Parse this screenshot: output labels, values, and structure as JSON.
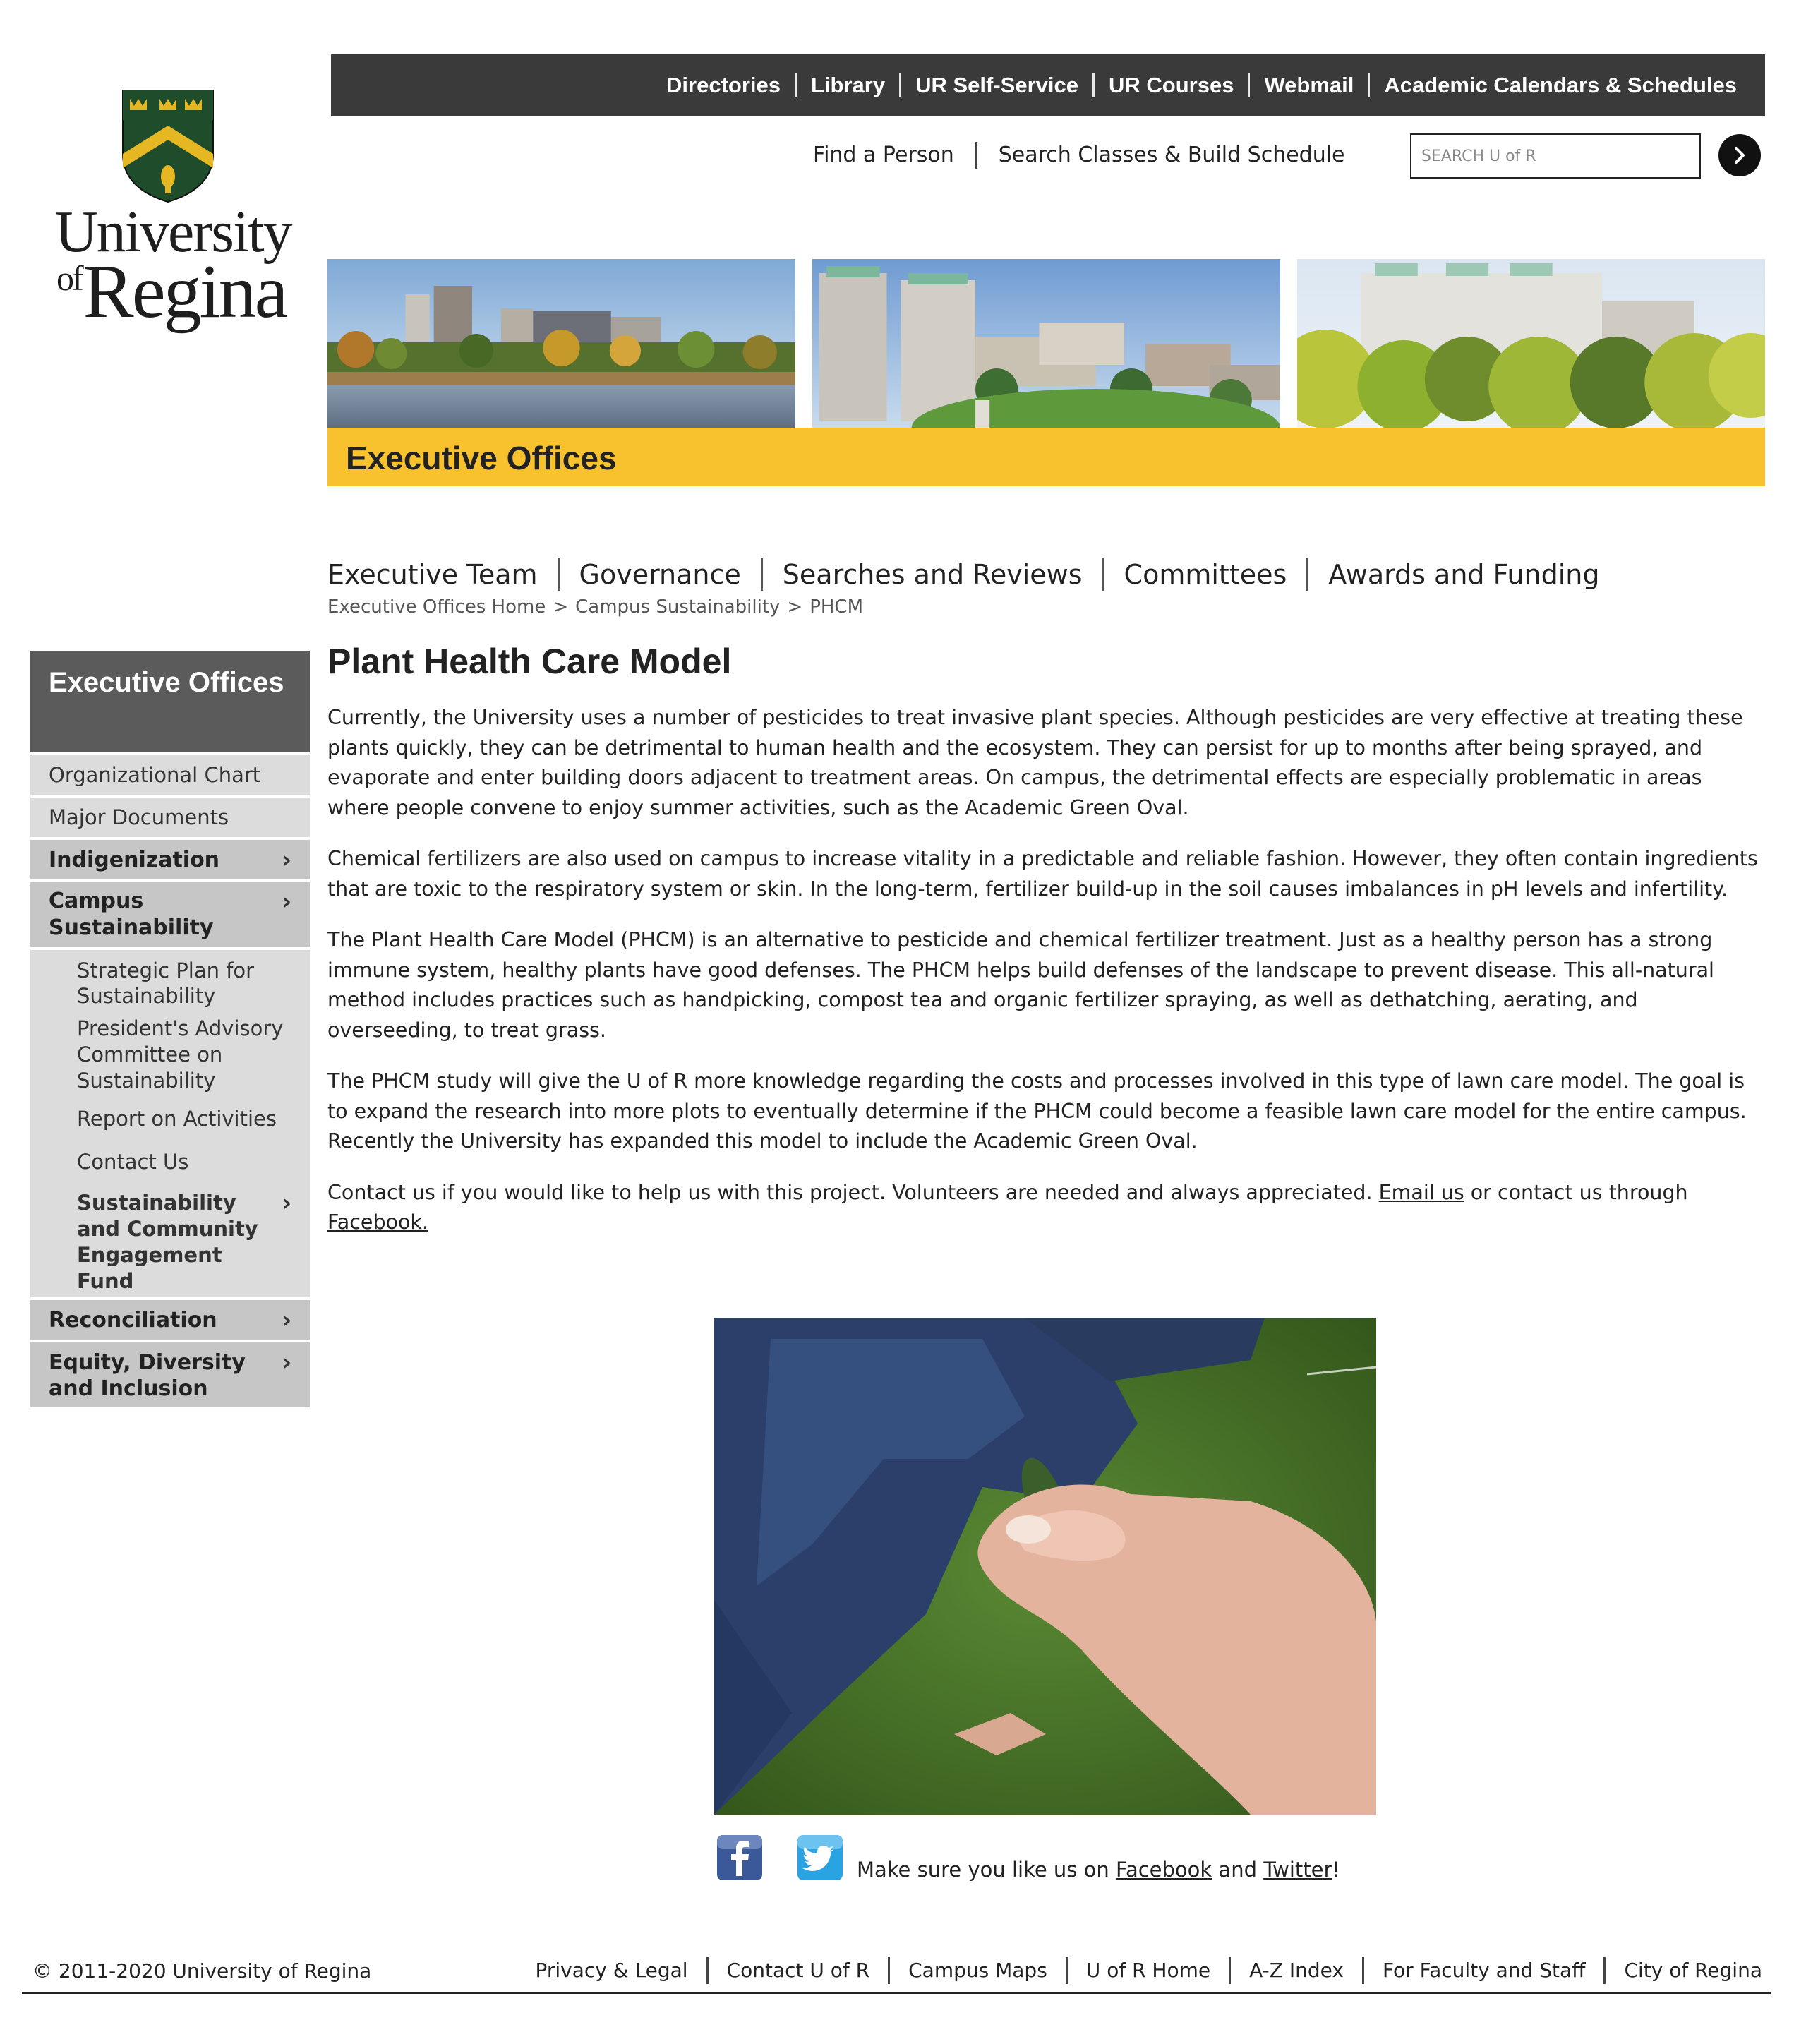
{
  "logo": {
    "line1": "University",
    "line2_prefix": "of",
    "line2": "Regina"
  },
  "topbar": {
    "items": [
      "Directories",
      "Library",
      "UR Self-Service",
      "UR Courses",
      "Webmail",
      "Academic Calendars & Schedules"
    ]
  },
  "sublinks": [
    "Find a Person",
    "Search Classes & Build Schedule"
  ],
  "search": {
    "placeholder": "SEARCH U of R"
  },
  "banner": {
    "title": "Executive Offices"
  },
  "mainnav": [
    "Executive Team",
    "Governance",
    "Searches and Reviews",
    "Committees",
    "Awards and Funding"
  ],
  "breadcrumb": [
    "Executive Offices Home",
    "Campus Sustainability",
    "PHCM"
  ],
  "breadcrumb_sep": ">",
  "sidebar": {
    "title": "Executive Offices",
    "items": [
      {
        "label": "Organizational Chart"
      },
      {
        "label": "Major Documents"
      },
      {
        "label": "Indigenization",
        "chevron": "›"
      },
      {
        "label": "Campus Sustainability",
        "chevron": "›"
      },
      {
        "label": "Strategic Plan for Sustainability"
      },
      {
        "label": "President's Advisory Committee on Sustainability"
      },
      {
        "label": "Report on Activities"
      },
      {
        "label": "Contact Us"
      },
      {
        "label": "Sustainability and Community Engagement Fund",
        "chevron": "›"
      },
      {
        "label": "Reconciliation",
        "chevron": "›"
      },
      {
        "label": "Equity, Diversity and Inclusion",
        "chevron": "›"
      }
    ]
  },
  "main": {
    "title": "Plant Health Care Model",
    "paragraphs": [
      "Currently, the University uses a number of pesticides to treat invasive plant species. Although pesticides are very effective at treating these plants quickly, they can be detrimental to human health and the ecosystem. They can persist for up to months after being sprayed, and evaporate and enter building doors adjacent to treatment areas. On campus, the detrimental effects are especially problematic in areas where people convene to enjoy summer activities, such as the Academic Green Oval.",
      "Chemical fertilizers are also used on campus to increase vitality in a predictable and reliable fashion.  However, they often contain ingredients that are toxic to the respiratory system or skin. In the long-term, fertilizer build-up in the soil causes imbalances in pH levels and infertility.",
      "The Plant Health Care Model (PHCM) is an alternative to pesticide and chemical fertilizer treatment. Just as a healthy person has a strong immune system, healthy plants have good defenses. The PHCM helps build defenses of the landscape to prevent disease. This all-natural method includes practices such as handpicking, compost tea and organic fertilizer spraying, as well as dethatching, aerating, and overseeding, to treat grass.",
      "The PHCM study will give the U of R more knowledge regarding the costs and processes involved in this type of lawn care model. The goal is to expand the research into more plots to eventually determine if the PHCM could become a feasible lawn care model for the entire campus. Recently the University has expanded this model to include the Academic Green Oval."
    ],
    "contact": {
      "before": "Contact us if you would like to help us with this project. Volunteers are needed and always appreciated. ",
      "email_link": "Email us",
      "middle": " or contact us through ",
      "facebook_link": "Facebook."
    }
  },
  "social": {
    "before": "Make sure you like us on ",
    "facebook": "Facebook",
    "and": " and ",
    "twitter": "Twitter",
    "after": "!",
    "icons": [
      "facebook-icon",
      "twitter-icon"
    ]
  },
  "footer": {
    "copyright": "© 2011-2020 University of Regina",
    "links": [
      "Privacy & Legal",
      "Contact U of R",
      "Campus Maps",
      "U of R Home",
      "A-Z Index",
      "For Faculty and Staff",
      "City of Regina"
    ]
  },
  "colors": {
    "topbar": "#3a3a3a",
    "banner_bar": "#f8c22f",
    "sidebar_title": "#5b5b5b",
    "sidebar_section": "#c6c6c6",
    "sidebar_item": "#dcdcdc",
    "crest_green": "#1f4d2b",
    "crest_gold": "#e5b823"
  }
}
